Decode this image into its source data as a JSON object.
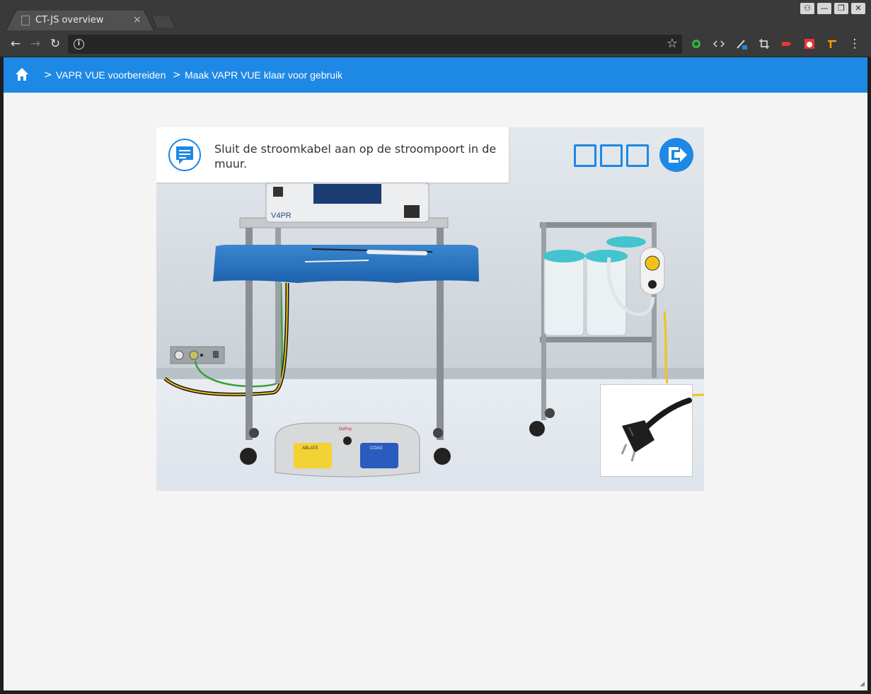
{
  "browser": {
    "tab_title": "CT-JS overview",
    "tab_close": "×",
    "window_buttons": [
      "⚇",
      "—",
      "❐",
      "✕"
    ],
    "address_value": ""
  },
  "toolbar": {
    "back": "←",
    "forward": "→",
    "reload": "↻",
    "star": "☆",
    "menu": "⋮"
  },
  "app": {
    "brand_color": "#1e88e5",
    "breadcrumbs": [
      "VAPR VUE voorbereiden",
      "Maak VAPR VUE klaar voor gebruik"
    ],
    "chevron": ">"
  },
  "lesson": {
    "instruction": "Sluit de stroomkabel aan op de stroompoort in de muur.",
    "progress_steps": 3,
    "device_label": "V4PR",
    "pedal_left": "ABLATE",
    "pedal_right": "COAG",
    "pedal_brand": "DePuy"
  }
}
